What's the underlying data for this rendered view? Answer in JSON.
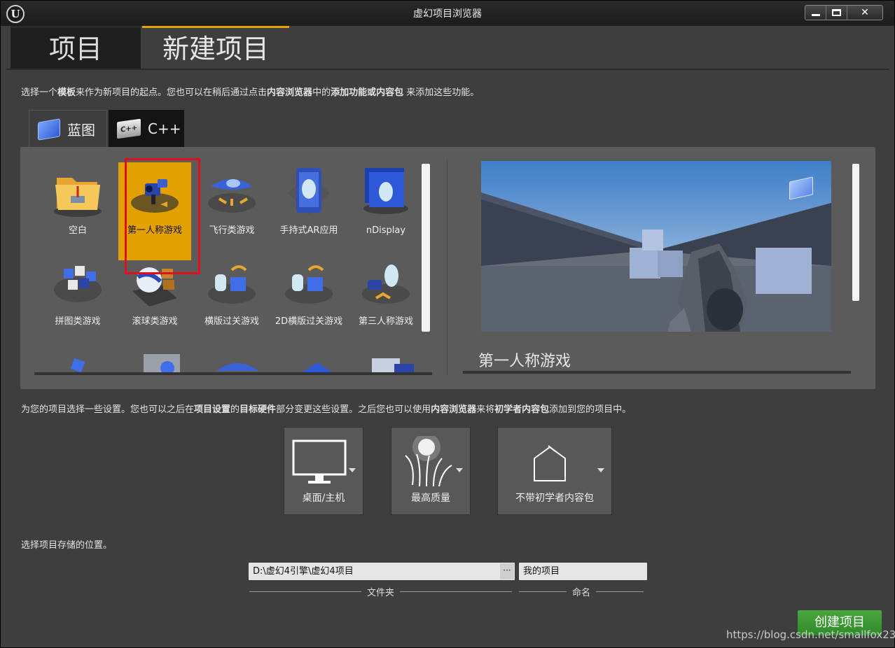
{
  "window": {
    "title": "虚幻项目浏览器"
  },
  "top_tabs": [
    "项目",
    "新建项目"
  ],
  "intro": {
    "p1": "选择一个",
    "b1": "模板",
    "p2": "来作为新项目的起点。您也可以在稍后通过点击",
    "b2": "内容浏览器",
    "p3": "中的",
    "b3": "添加功能或内容包",
    "p4": " 来添加这些功能。"
  },
  "sub_tabs": {
    "blueprint": "蓝图",
    "cpp": "C++",
    "cpp_icon": "C++"
  },
  "templates": [
    {
      "label": "空白",
      "icon": "folder-icon"
    },
    {
      "label": "第一人称游戏",
      "icon": "first-person-icon",
      "selected": true
    },
    {
      "label": "飞行类游戏",
      "icon": "flying-icon"
    },
    {
      "label": "手持式AR应用",
      "icon": "ar-icon"
    },
    {
      "label": "nDisplay",
      "icon": "ndisplay-icon"
    },
    {
      "label": "拼图类游戏",
      "icon": "puzzle-icon"
    },
    {
      "label": "滚球类游戏",
      "icon": "rolling-icon"
    },
    {
      "label": "横版过关游戏",
      "icon": "side-scroller-icon"
    },
    {
      "label": "2D横版过关游戏",
      "icon": "2d-side-scroller-icon"
    },
    {
      "label": "第三人称游戏",
      "icon": "third-person-icon"
    }
  ],
  "preview": {
    "title": "第一人称游戏"
  },
  "settings_intro": {
    "p1": "为您的项目选择一些设置。您也可以之后在",
    "b1": "项目设置",
    "p2": "的",
    "b2": "目标硬件",
    "p3": "部分变更这些设置。之后您也可以使用",
    "b3": "内容浏览器",
    "p4": "来将",
    "b4": "初学者内容包",
    "p5": "添加到您的项目中。"
  },
  "settings": [
    {
      "label": "桌面/主机",
      "icon": "monitor-icon"
    },
    {
      "label": "最高质量",
      "icon": "quality-icon"
    },
    {
      "label": "不带初学者内容包",
      "icon": "empty-box-icon"
    }
  ],
  "location": {
    "intro": "选择项目存储的位置。",
    "folder_path": "D:\\虚幻4引擎\\虚幻4项目",
    "browse": "···",
    "name": "我的项目",
    "folder_caption": "文件夹",
    "name_caption": "命名"
  },
  "create_button": "创建项目",
  "watermark": "https://blog.csdn.net/smallfox233",
  "colors": {
    "accent": "#e3a100",
    "create": "#3c9a34",
    "highlight": "#e0101a"
  }
}
